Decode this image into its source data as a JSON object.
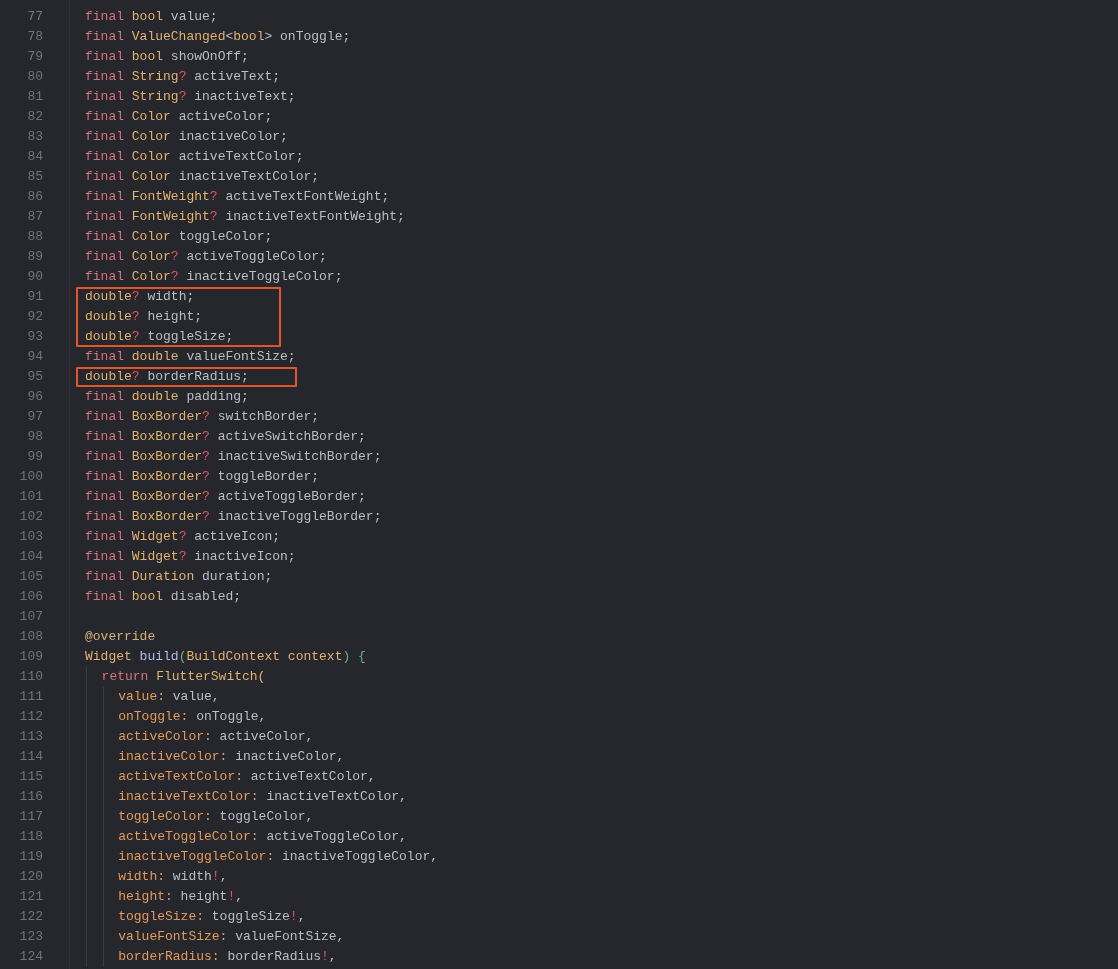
{
  "code_lines": [
    {
      "number": "77",
      "highlighted": false,
      "tokens": [
        {
          "kind": "keyword",
          "text": "final "
        },
        {
          "kind": "type",
          "text": "bool"
        },
        {
          "kind": "plain",
          "text": " value;"
        }
      ]
    },
    {
      "number": "78",
      "highlighted": false,
      "tokens": [
        {
          "kind": "keyword",
          "text": "final "
        },
        {
          "kind": "type",
          "text": "ValueChanged"
        },
        {
          "kind": "plain",
          "text": "<"
        },
        {
          "kind": "type",
          "text": "bool"
        },
        {
          "kind": "plain",
          "text": "> onToggle;"
        }
      ]
    },
    {
      "number": "79",
      "highlighted": false,
      "tokens": [
        {
          "kind": "keyword",
          "text": "final "
        },
        {
          "kind": "type",
          "text": "bool"
        },
        {
          "kind": "plain",
          "text": " showOnOff;"
        }
      ]
    },
    {
      "number": "80",
      "highlighted": false,
      "tokens": [
        {
          "kind": "keyword",
          "text": "final "
        },
        {
          "kind": "type",
          "text": "String"
        },
        {
          "kind": "nullable",
          "text": "?"
        },
        {
          "kind": "plain",
          "text": " activeText;"
        }
      ]
    },
    {
      "number": "81",
      "highlighted": false,
      "tokens": [
        {
          "kind": "keyword",
          "text": "final "
        },
        {
          "kind": "type",
          "text": "String"
        },
        {
          "kind": "nullable",
          "text": "?"
        },
        {
          "kind": "plain",
          "text": " inactiveText;"
        }
      ]
    },
    {
      "number": "82",
      "highlighted": false,
      "tokens": [
        {
          "kind": "keyword",
          "text": "final "
        },
        {
          "kind": "type",
          "text": "Color"
        },
        {
          "kind": "plain",
          "text": " activeColor;"
        }
      ]
    },
    {
      "number": "83",
      "highlighted": false,
      "tokens": [
        {
          "kind": "keyword",
          "text": "final "
        },
        {
          "kind": "type",
          "text": "Color"
        },
        {
          "kind": "plain",
          "text": " inactiveColor;"
        }
      ]
    },
    {
      "number": "84",
      "highlighted": false,
      "tokens": [
        {
          "kind": "keyword",
          "text": "final "
        },
        {
          "kind": "type",
          "text": "Color"
        },
        {
          "kind": "plain",
          "text": " activeTextColor;"
        }
      ]
    },
    {
      "number": "85",
      "highlighted": false,
      "tokens": [
        {
          "kind": "keyword",
          "text": "final "
        },
        {
          "kind": "type",
          "text": "Color"
        },
        {
          "kind": "plain",
          "text": " inactiveTextColor;"
        }
      ]
    },
    {
      "number": "86",
      "highlighted": false,
      "tokens": [
        {
          "kind": "keyword",
          "text": "final "
        },
        {
          "kind": "type",
          "text": "FontWeight"
        },
        {
          "kind": "nullable",
          "text": "?"
        },
        {
          "kind": "plain",
          "text": " activeTextFontWeight;"
        }
      ]
    },
    {
      "number": "87",
      "highlighted": false,
      "tokens": [
        {
          "kind": "keyword",
          "text": "final "
        },
        {
          "kind": "type",
          "text": "FontWeight"
        },
        {
          "kind": "nullable",
          "text": "?"
        },
        {
          "kind": "plain",
          "text": " inactiveTextFontWeight;"
        }
      ]
    },
    {
      "number": "88",
      "highlighted": false,
      "tokens": [
        {
          "kind": "keyword",
          "text": "final "
        },
        {
          "kind": "type",
          "text": "Color"
        },
        {
          "kind": "plain",
          "text": " toggleColor;"
        }
      ]
    },
    {
      "number": "89",
      "highlighted": false,
      "tokens": [
        {
          "kind": "keyword",
          "text": "final "
        },
        {
          "kind": "type",
          "text": "Color"
        },
        {
          "kind": "nullable",
          "text": "?"
        },
        {
          "kind": "plain",
          "text": " activeToggleColor;"
        }
      ]
    },
    {
      "number": "90",
      "highlighted": false,
      "tokens": [
        {
          "kind": "keyword",
          "text": "final "
        },
        {
          "kind": "type",
          "text": "Color"
        },
        {
          "kind": "nullable",
          "text": "?"
        },
        {
          "kind": "plain",
          "text": " inactiveToggleColor;"
        }
      ]
    },
    {
      "number": "91",
      "highlighted": true,
      "tokens": [
        {
          "kind": "type",
          "text": "double"
        },
        {
          "kind": "nullable",
          "text": "?"
        },
        {
          "kind": "plain",
          "text": " width;"
        }
      ]
    },
    {
      "number": "92",
      "highlighted": true,
      "tokens": [
        {
          "kind": "type",
          "text": "double"
        },
        {
          "kind": "nullable",
          "text": "?"
        },
        {
          "kind": "plain",
          "text": " height;"
        }
      ]
    },
    {
      "number": "93",
      "highlighted": true,
      "tokens": [
        {
          "kind": "type",
          "text": "double"
        },
        {
          "kind": "nullable",
          "text": "?"
        },
        {
          "kind": "plain",
          "text": " toggleSize;"
        }
      ]
    },
    {
      "number": "94",
      "highlighted": false,
      "tokens": [
        {
          "kind": "keyword",
          "text": "final "
        },
        {
          "kind": "type",
          "text": "double"
        },
        {
          "kind": "plain",
          "text": " valueFontSize;"
        }
      ]
    },
    {
      "number": "95",
      "highlighted": true,
      "tokens": [
        {
          "kind": "type",
          "text": "double"
        },
        {
          "kind": "nullable",
          "text": "?"
        },
        {
          "kind": "plain",
          "text": " borderRadius;"
        }
      ]
    },
    {
      "number": "96",
      "highlighted": false,
      "tokens": [
        {
          "kind": "keyword",
          "text": "final "
        },
        {
          "kind": "type",
          "text": "double"
        },
        {
          "kind": "plain",
          "text": " padding;"
        }
      ]
    },
    {
      "number": "97",
      "highlighted": false,
      "tokens": [
        {
          "kind": "keyword",
          "text": "final "
        },
        {
          "kind": "type",
          "text": "BoxBorder"
        },
        {
          "kind": "nullable",
          "text": "?"
        },
        {
          "kind": "plain",
          "text": " switchBorder;"
        }
      ]
    },
    {
      "number": "98",
      "highlighted": false,
      "tokens": [
        {
          "kind": "keyword",
          "text": "final "
        },
        {
          "kind": "type",
          "text": "BoxBorder"
        },
        {
          "kind": "nullable",
          "text": "?"
        },
        {
          "kind": "plain",
          "text": " activeSwitchBorder;"
        }
      ]
    },
    {
      "number": "99",
      "highlighted": false,
      "tokens": [
        {
          "kind": "keyword",
          "text": "final "
        },
        {
          "kind": "type",
          "text": "BoxBorder"
        },
        {
          "kind": "nullable",
          "text": "?"
        },
        {
          "kind": "plain",
          "text": " inactiveSwitchBorder;"
        }
      ]
    },
    {
      "number": "100",
      "highlighted": false,
      "tokens": [
        {
          "kind": "keyword",
          "text": "final "
        },
        {
          "kind": "type",
          "text": "BoxBorder"
        },
        {
          "kind": "nullable",
          "text": "?"
        },
        {
          "kind": "plain",
          "text": " toggleBorder;"
        }
      ]
    },
    {
      "number": "101",
      "highlighted": false,
      "tokens": [
        {
          "kind": "keyword",
          "text": "final "
        },
        {
          "kind": "type",
          "text": "BoxBorder"
        },
        {
          "kind": "nullable",
          "text": "?"
        },
        {
          "kind": "plain",
          "text": " activeToggleBorder;"
        }
      ]
    },
    {
      "number": "102",
      "highlighted": false,
      "tokens": [
        {
          "kind": "keyword",
          "text": "final "
        },
        {
          "kind": "type",
          "text": "BoxBorder"
        },
        {
          "kind": "nullable",
          "text": "?"
        },
        {
          "kind": "plain",
          "text": " inactiveToggleBorder;"
        }
      ]
    },
    {
      "number": "103",
      "highlighted": false,
      "tokens": [
        {
          "kind": "keyword",
          "text": "final "
        },
        {
          "kind": "type",
          "text": "Widget"
        },
        {
          "kind": "nullable",
          "text": "?"
        },
        {
          "kind": "plain",
          "text": " activeIcon;"
        }
      ]
    },
    {
      "number": "104",
      "highlighted": false,
      "tokens": [
        {
          "kind": "keyword",
          "text": "final "
        },
        {
          "kind": "type",
          "text": "Widget"
        },
        {
          "kind": "nullable",
          "text": "?"
        },
        {
          "kind": "plain",
          "text": " inactiveIcon;"
        }
      ]
    },
    {
      "number": "105",
      "highlighted": false,
      "tokens": [
        {
          "kind": "keyword",
          "text": "final "
        },
        {
          "kind": "type",
          "text": "Duration"
        },
        {
          "kind": "plain",
          "text": " duration;"
        }
      ]
    },
    {
      "number": "106",
      "highlighted": false,
      "tokens": [
        {
          "kind": "keyword",
          "text": "final "
        },
        {
          "kind": "type",
          "text": "bool"
        },
        {
          "kind": "plain",
          "text": " disabled;"
        }
      ]
    },
    {
      "number": "107",
      "highlighted": false
    },
    {
      "number": "108",
      "highlighted": false,
      "tokens": [
        {
          "kind": "annotation",
          "text": "@override"
        }
      ]
    },
    {
      "number": "109",
      "highlighted": false,
      "tokens": [
        {
          "kind": "type",
          "text": "Widget "
        },
        {
          "kind": "method",
          "text": "build"
        },
        {
          "kind": "brace",
          "text": "("
        },
        {
          "kind": "type",
          "text": "BuildContext context"
        },
        {
          "kind": "brace",
          "text": ") {"
        }
      ],
      "children": [
        {
          "number": "110",
          "highlighted": false,
          "tokens": [
            {
              "kind": "keyword",
              "text": "return "
            },
            {
              "kind": "type",
              "text": "FlutterSwitch("
            }
          ],
          "children": [
            {
              "number": "111",
              "highlighted": false,
              "tokens": [
                {
                  "kind": "argument",
                  "text": "value:"
                },
                {
                  "kind": "plain",
                  "text": " value,"
                }
              ]
            },
            {
              "number": "112",
              "highlighted": false,
              "tokens": [
                {
                  "kind": "argument",
                  "text": "onToggle:"
                },
                {
                  "kind": "plain",
                  "text": " onToggle,"
                }
              ]
            },
            {
              "number": "113",
              "highlighted": false,
              "tokens": [
                {
                  "kind": "argument",
                  "text": "activeColor:"
                },
                {
                  "kind": "plain",
                  "text": " activeColor,"
                }
              ]
            },
            {
              "number": "114",
              "highlighted": false,
              "tokens": [
                {
                  "kind": "argument",
                  "text": "inactiveColor:"
                },
                {
                  "kind": "plain",
                  "text": " inactiveColor,"
                }
              ]
            },
            {
              "number": "115",
              "highlighted": false,
              "tokens": [
                {
                  "kind": "argument",
                  "text": "activeTextColor:"
                },
                {
                  "kind": "plain",
                  "text": " activeTextColor,"
                }
              ]
            },
            {
              "number": "116",
              "highlighted": false,
              "tokens": [
                {
                  "kind": "argument",
                  "text": "inactiveTextColor:"
                },
                {
                  "kind": "plain",
                  "text": " inactiveTextColor,"
                }
              ]
            },
            {
              "number": "117",
              "highlighted": false,
              "tokens": [
                {
                  "kind": "argument",
                  "text": "toggleColor:"
                },
                {
                  "kind": "plain",
                  "text": " toggleColor,"
                }
              ]
            },
            {
              "number": "118",
              "highlighted": false,
              "tokens": [
                {
                  "kind": "argument",
                  "text": "activeToggleColor:"
                },
                {
                  "kind": "plain",
                  "text": " activeToggleColor,"
                }
              ]
            },
            {
              "number": "119",
              "highlighted": false,
              "tokens": [
                {
                  "kind": "argument",
                  "text": "inactiveToggleColor:"
                },
                {
                  "kind": "plain",
                  "text": " inactiveToggleColor,"
                }
              ]
            },
            {
              "number": "120",
              "highlighted": false,
              "tokens": [
                {
                  "kind": "argument",
                  "text": "width:"
                },
                {
                  "kind": "plain",
                  "text": " width"
                },
                {
                  "kind": "nullable",
                  "text": "!"
                },
                {
                  "kind": "plain",
                  "text": ","
                }
              ]
            },
            {
              "number": "121",
              "highlighted": false,
              "tokens": [
                {
                  "kind": "argument",
                  "text": "height:"
                },
                {
                  "kind": "plain",
                  "text": " height"
                },
                {
                  "kind": "nullable",
                  "text": "!"
                },
                {
                  "kind": "plain",
                  "text": ","
                }
              ]
            },
            {
              "number": "122",
              "highlighted": false,
              "tokens": [
                {
                  "kind": "argument",
                  "text": "toggleSize:"
                },
                {
                  "kind": "plain",
                  "text": " toggleSize"
                },
                {
                  "kind": "nullable",
                  "text": "!"
                },
                {
                  "kind": "plain",
                  "text": ","
                }
              ]
            },
            {
              "number": "123",
              "highlighted": false,
              "tokens": [
                {
                  "kind": "argument",
                  "text": "valueFontSize:"
                },
                {
                  "kind": "plain",
                  "text": " valueFontSize,"
                }
              ]
            },
            {
              "number": "124",
              "highlighted": false,
              "tokens": [
                {
                  "kind": "argument",
                  "text": "borderRadius:"
                },
                {
                  "kind": "plain",
                  "text": " borderRadius"
                },
                {
                  "kind": "nullable",
                  "text": "!"
                },
                {
                  "kind": "plain",
                  "text": ","
                }
              ]
            }
          ]
        }
      ]
    }
  ]
}
